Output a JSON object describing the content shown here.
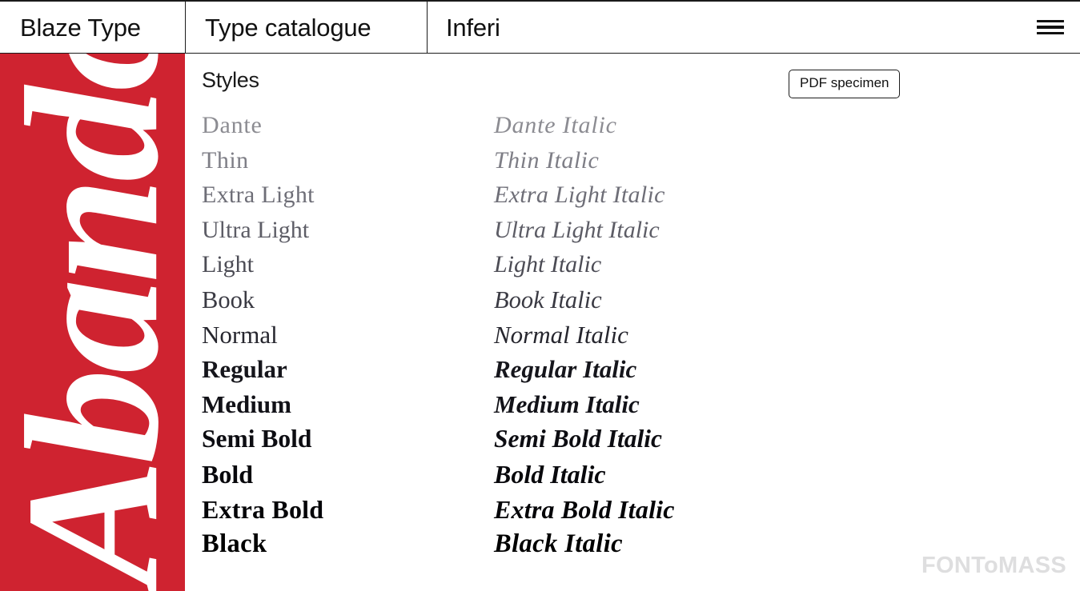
{
  "header": {
    "brand": "Blaze Type",
    "catalogue_link": "Type catalogue",
    "typeface_name": "Inferi",
    "menu_icon": "hamburger-menu-icon"
  },
  "cover": {
    "word": "Abando",
    "background_color": "#cf2330",
    "text_color": "#ffffff"
  },
  "main": {
    "section_heading": "Styles",
    "pdf_button_label": "PDF specimen"
  },
  "styles": [
    {
      "upright": "Dante",
      "italic": "Dante Italic",
      "weight_class": "w-dante"
    },
    {
      "upright": "Thin",
      "italic": "Thin Italic",
      "weight_class": "w-thin"
    },
    {
      "upright": "Extra Light",
      "italic": "Extra Light Italic",
      "weight_class": "w-exlt"
    },
    {
      "upright": "Ultra Light",
      "italic": "Ultra Light Italic",
      "weight_class": "w-ullt"
    },
    {
      "upright": "Light",
      "italic": "Light Italic",
      "weight_class": "w-light"
    },
    {
      "upright": "Book",
      "italic": "Book Italic",
      "weight_class": "w-book"
    },
    {
      "upright": "Normal",
      "italic": "Normal Italic",
      "weight_class": "w-normal"
    },
    {
      "upright": "Regular",
      "italic": "Regular Italic",
      "weight_class": "w-reg"
    },
    {
      "upright": "Medium",
      "italic": "Medium Italic",
      "weight_class": "w-med"
    },
    {
      "upright": "Semi Bold",
      "italic": "Semi Bold Italic",
      "weight_class": "w-semi"
    },
    {
      "upright": "Bold",
      "italic": "Bold Italic",
      "weight_class": "w-bold"
    },
    {
      "upright": "Extra Bold",
      "italic": "Extra Bold Italic",
      "weight_class": "w-exbd"
    },
    {
      "upright": "Black",
      "italic": "Black Italic",
      "weight_class": "w-black"
    }
  ],
  "footer": {
    "watermark": "FONToMASS"
  },
  "colors": {
    "accent_red": "#cf2330",
    "text": "#111111",
    "watermark": "#dededf",
    "border": "#1b1b1b"
  }
}
